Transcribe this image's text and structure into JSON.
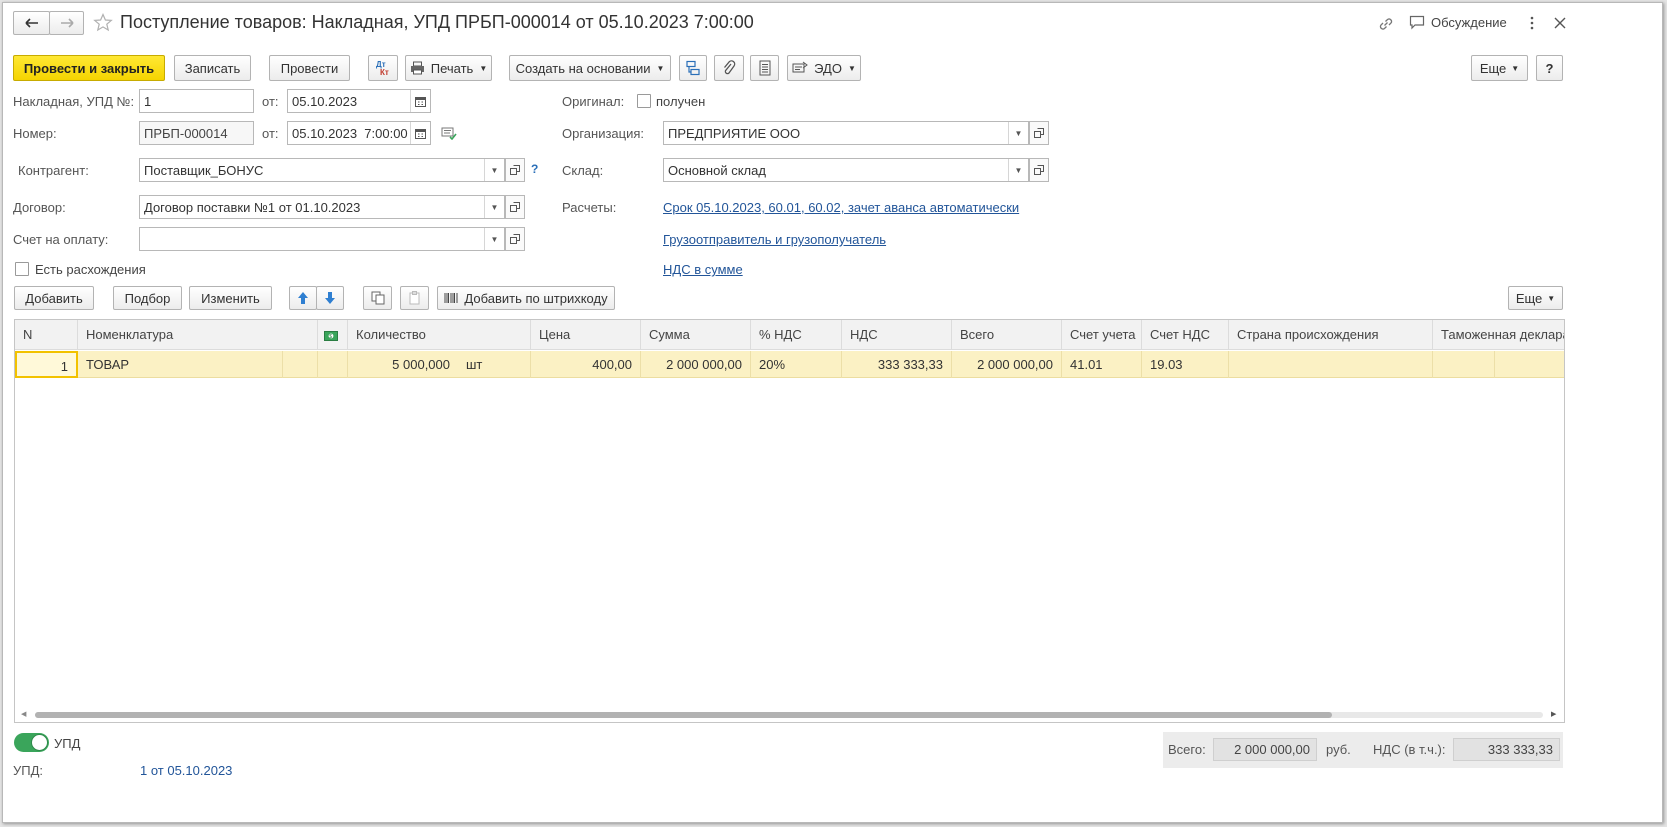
{
  "window": {
    "title": "Поступление товаров: Накладная, УПД ПРБП-000014 от 05.10.2023 7:00:00",
    "discussion": "Обсуждение"
  },
  "toolbar": {
    "post_close": "Провести и закрыть",
    "save": "Записать",
    "post": "Провести",
    "print": "Печать",
    "create_based": "Создать на основании",
    "edo": "ЭДО",
    "more": "Еще",
    "help": "?"
  },
  "header": {
    "invoice_label": "Накладная, УПД №:",
    "invoice_no": "1",
    "from_label": "от:",
    "invoice_date": "05.10.2023",
    "number_label": "Номер:",
    "number": "ПРБП-000014",
    "number_from_label": "от:",
    "number_date": "05.10.2023  7:00:00",
    "counterparty_label": "Контрагент:",
    "counterparty": "Поставщик_БОНУС",
    "contract_label": "Договор:",
    "contract": "Договор поставки №1 от 01.10.2023",
    "payment_label": "Счет на оплату:",
    "payment": "",
    "discrepancy_label": "Есть расхождения",
    "original_label": "Оригинал:",
    "original_received_label": "получен",
    "org_label": "Организация:",
    "org": "ПРЕДПРИЯТИЕ ООО",
    "warehouse_label": "Склад:",
    "warehouse": "Основной склад",
    "settlements_label": "Расчеты:",
    "settlements_link": "Срок 05.10.2023, 60.01, 60.02, зачет аванса автоматически",
    "shipper_link": "Грузоотправитель и грузополучатель",
    "vat_link": "НДС в сумме"
  },
  "table_toolbar": {
    "add": "Добавить",
    "pick": "Подбор",
    "change": "Изменить",
    "barcode": "Добавить по штрихкоду",
    "more": "Еще"
  },
  "table": {
    "columns": [
      "N",
      "Номенклатура",
      "",
      "Количество",
      "Цена",
      "Сумма",
      "% НДС",
      "НДС",
      "Всего",
      "Счет учета",
      "Счет НДС",
      "Страна происхождения",
      "Таможенная деклара"
    ],
    "rows": [
      {
        "n": "1",
        "item": "ТОВАР",
        "qty": "5 000,000",
        "unit": "шт",
        "price": "400,00",
        "sum": "2 000 000,00",
        "vat_rate": "20%",
        "vat": "333 333,33",
        "total": "2 000 000,00",
        "account": "41.01",
        "vat_account": "19.03",
        "country": "",
        "customs": ""
      }
    ]
  },
  "footer": {
    "upd_toggle": "УПД",
    "upd_label": "УПД:",
    "upd_link": "1 от 05.10.2023",
    "total_label": "Всего:",
    "total_value": "2 000 000,00",
    "currency": "руб.",
    "vat_label": "НДС (в т.ч.):",
    "vat_value": "333 333,33"
  },
  "colors": {
    "primary_button": "#f5d400",
    "link": "#225599",
    "selected_row": "#fbf1c4",
    "toggle_on": "#3aa55b"
  }
}
